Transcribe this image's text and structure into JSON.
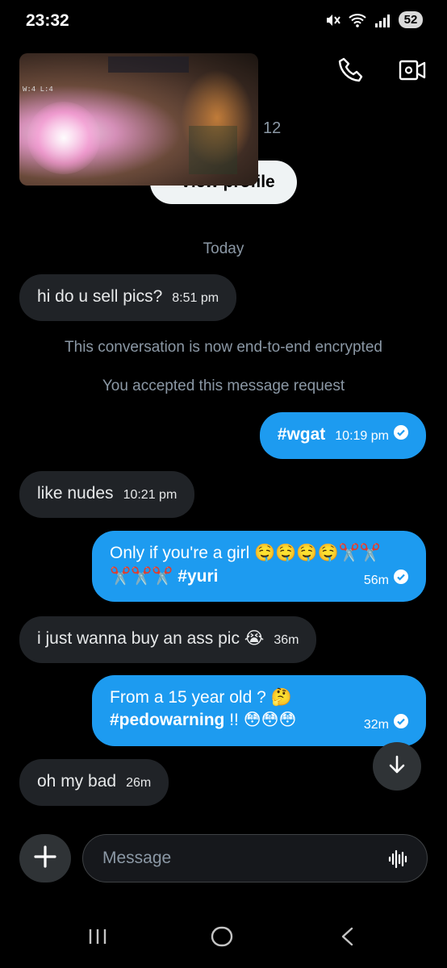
{
  "status_bar": {
    "time": "23:32",
    "battery": "52",
    "icons": [
      "mute-icon",
      "wifi-icon",
      "signal-icon",
      "battery-icon"
    ]
  },
  "header": {
    "icons": [
      "phone-call-icon",
      "video-call-icon"
    ]
  },
  "profile": {
    "handle_tail": "12",
    "view_profile_label": "View profile",
    "thumbnail_hud_text": "W:4 L:4"
  },
  "chat": {
    "date_label": "Today",
    "system_messages": [
      "This conversation is now end-to-end encrypted",
      "You accepted this message request"
    ],
    "messages": [
      {
        "direction": "in",
        "text": "hi do u sell pics?",
        "time": "8:51 pm"
      },
      {
        "direction": "out",
        "tag": "#wgat",
        "time": "10:19 pm",
        "status": "read"
      },
      {
        "direction": "in",
        "text": "like nudes",
        "time": "10:21 pm"
      },
      {
        "direction": "out",
        "line1": "Only if you're a girl 🤤🤤🤤🤤✂️✂️",
        "line2_prefix": "✂️✂️✂️",
        "tag": "#yuri",
        "time": "56m",
        "status": "read"
      },
      {
        "direction": "in",
        "text": "i just wanna buy an ass pic 😭",
        "time": "36m"
      },
      {
        "direction": "out",
        "line1": "From a 15 year old ? 🤔",
        "tag": "#pedowarning",
        "line2_suffix": "!! 😳😳😳",
        "time": "32m",
        "status": "read"
      },
      {
        "direction": "in",
        "text": "oh my bad",
        "time": "26m"
      }
    ]
  },
  "composer": {
    "placeholder": "Message"
  },
  "colors": {
    "background": "#000000",
    "incoming_bubble": "#202327",
    "outgoing_bubble": "#1d9bf0",
    "muted_text": "#8b98a5"
  }
}
